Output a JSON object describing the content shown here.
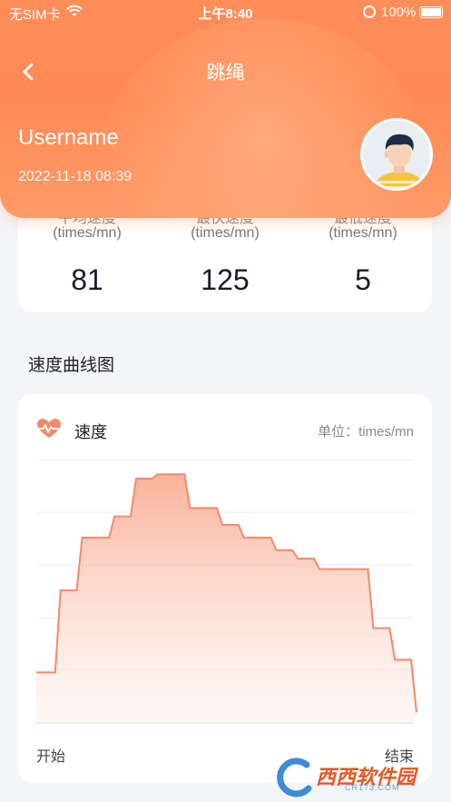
{
  "status_bar": {
    "carrier": "无SIM卡",
    "time": "上午8:40",
    "battery": "100%"
  },
  "header": {
    "title": "跳绳",
    "username": "Username",
    "datetime": "2022-11-18 08:39"
  },
  "stats": [
    {
      "label": "平均速度",
      "unit": "(times/mn)",
      "value": "81"
    },
    {
      "label": "最快速度",
      "unit": "(times/mn)",
      "value": "125"
    },
    {
      "label": "最低速度",
      "unit": "(times/mn)",
      "value": "5"
    }
  ],
  "section_title": "速度曲线图",
  "chart_card": {
    "title": "速度",
    "unit_label": "单位：times/mn",
    "x_start": "开始",
    "x_end": "结束",
    "accent_color": "#f28a6c"
  },
  "chart_data": {
    "type": "area",
    "title": "",
    "xlabel": "",
    "ylabel": "",
    "ylim": [
      0,
      125
    ],
    "grid": true,
    "y_ticks_shown": false,
    "x": [
      0,
      1,
      2,
      3,
      4,
      5,
      6,
      7,
      8,
      9,
      10,
      11,
      12,
      13,
      14,
      15,
      16,
      17,
      18,
      19,
      20,
      21,
      22,
      23,
      24,
      25,
      26,
      27,
      28,
      29,
      30,
      31,
      32,
      33,
      34,
      35
    ],
    "series": [
      {
        "values": [
          24,
          24,
          63,
          63,
          88,
          88,
          88,
          98,
          98,
          116,
          116,
          118,
          118,
          118,
          102,
          102,
          102,
          94,
          94,
          88,
          88,
          88,
          82,
          82,
          78,
          78,
          73,
          73,
          73,
          73,
          73,
          45,
          45,
          30,
          30,
          5
        ]
      }
    ]
  },
  "watermark": {
    "text": "西西软件园",
    "sub": "CR173.COM"
  },
  "colors": {
    "header_orange": "#ff8a55",
    "line": "#f28a6c",
    "fill_top": "#fbb9a3"
  }
}
